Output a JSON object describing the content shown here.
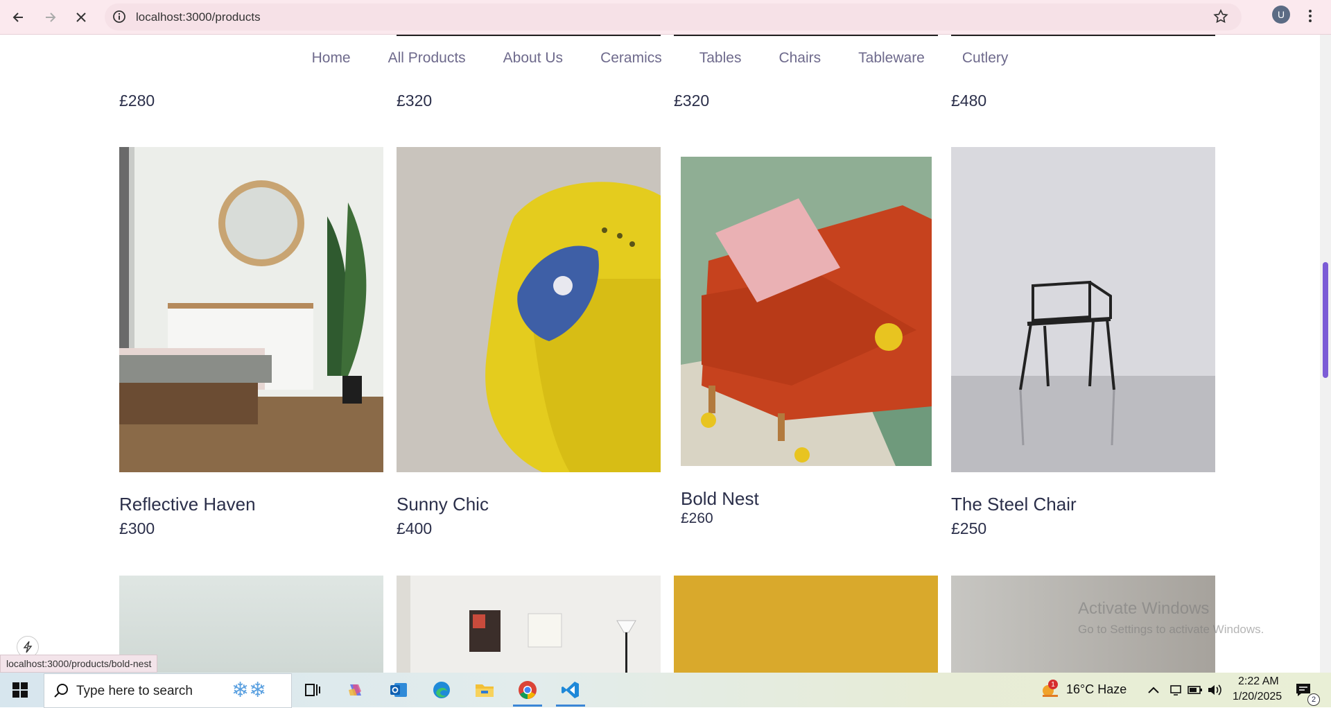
{
  "browser": {
    "url": "localhost:3000/products",
    "profile_initial": "U"
  },
  "nav": {
    "items": [
      "Home",
      "All Products",
      "About Us",
      "Ceramics",
      "Tables",
      "Chairs",
      "Tableware",
      "Cutlery"
    ]
  },
  "top_row_prices": [
    "£280",
    "£320",
    "£320",
    "£480"
  ],
  "products": [
    {
      "name": "Reflective Haven",
      "price": "£300"
    },
    {
      "name": "Sunny Chic",
      "price": "£400"
    },
    {
      "name": "Bold Nest",
      "price": "£260"
    },
    {
      "name": "The Steel Chair",
      "price": "£250"
    }
  ],
  "watermark": {
    "title": "Activate Windows",
    "subtitle": "Go to Settings to activate Windows."
  },
  "status_bar_url": "localhost:3000/products/bold-nest",
  "taskbar": {
    "search_placeholder": "Type here to search",
    "weather": "16°C  Haze",
    "weather_badge": "1",
    "time": "2:22 AM",
    "date": "1/20/2025",
    "notification_count": "2"
  },
  "colors": {
    "accent": "#7c5cd6",
    "nav_text": "#6e6a8c",
    "heading_text": "#2b2f4a"
  }
}
